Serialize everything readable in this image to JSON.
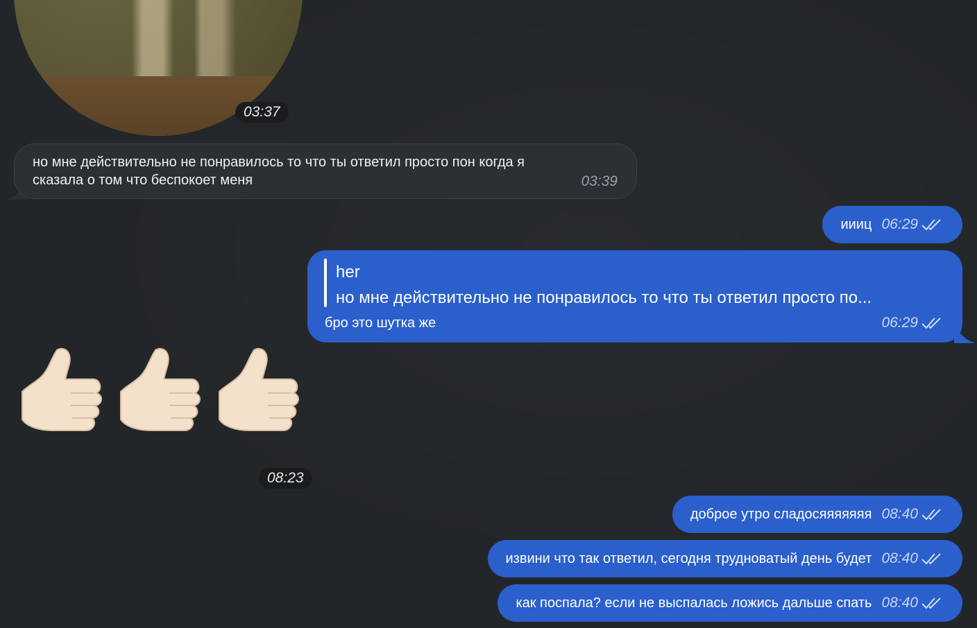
{
  "messages": {
    "video_time": "03:37",
    "in1": {
      "text_line1": "но мне действительно не понравилось то что ты ответил просто пон когда я",
      "text_line2": "сказала о том что беспокоет меня",
      "time": "03:39"
    },
    "out1": {
      "text": "иииц",
      "time": "06:29"
    },
    "out2": {
      "reply_author": "her",
      "reply_text": "но мне действительно не понравилось то что ты ответил просто по...",
      "text": "бро это шутка же",
      "time": "06:29"
    },
    "thumbs_time": "08:23",
    "out3": {
      "text": "доброе утро сладосяяяяяяя",
      "time": "08:40"
    },
    "out4": {
      "text": "извини что так ответил, сегодня трудноватый день будет",
      "time": "08:40"
    },
    "out5": {
      "text": "как поспала? если не выспалась ложись дальше спать",
      "time": "08:40"
    }
  },
  "colors": {
    "background": "#232629",
    "incoming": "#2c2f33",
    "outgoing": "#2b5fcc"
  },
  "icons": {
    "read_status": "double-check-icon",
    "sticker": "thumbs-up-emoji"
  }
}
